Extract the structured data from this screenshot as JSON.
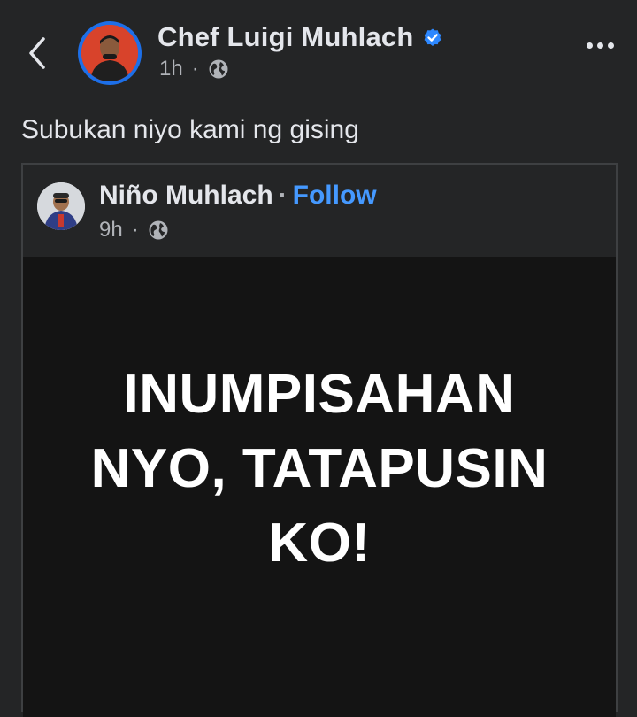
{
  "post": {
    "author_name": "Chef Luigi Muhlach",
    "time": "1h",
    "separator": "·",
    "caption": "Subukan niyo kami ng gising"
  },
  "shared_post": {
    "author_name": "Niño Muhlach",
    "separator": "·",
    "follow_label": "Follow",
    "time": "9h",
    "image_text_lines": [
      "INUMPISAHAN",
      "NYO, TATAPUSIN",
      "KO!"
    ]
  },
  "icons": {
    "back": "chevron-left-icon",
    "verified": "verified-badge-icon",
    "audience": "globe-icon",
    "more": "more-horizontal-icon"
  },
  "colors": {
    "background": "#242526",
    "text_primary": "#e4e6eb",
    "text_secondary": "#b0b3b8",
    "link": "#4599ff",
    "verified": "#2d88ff",
    "avatar_ring": "#1d6fe8",
    "image_bg": "#141414"
  }
}
